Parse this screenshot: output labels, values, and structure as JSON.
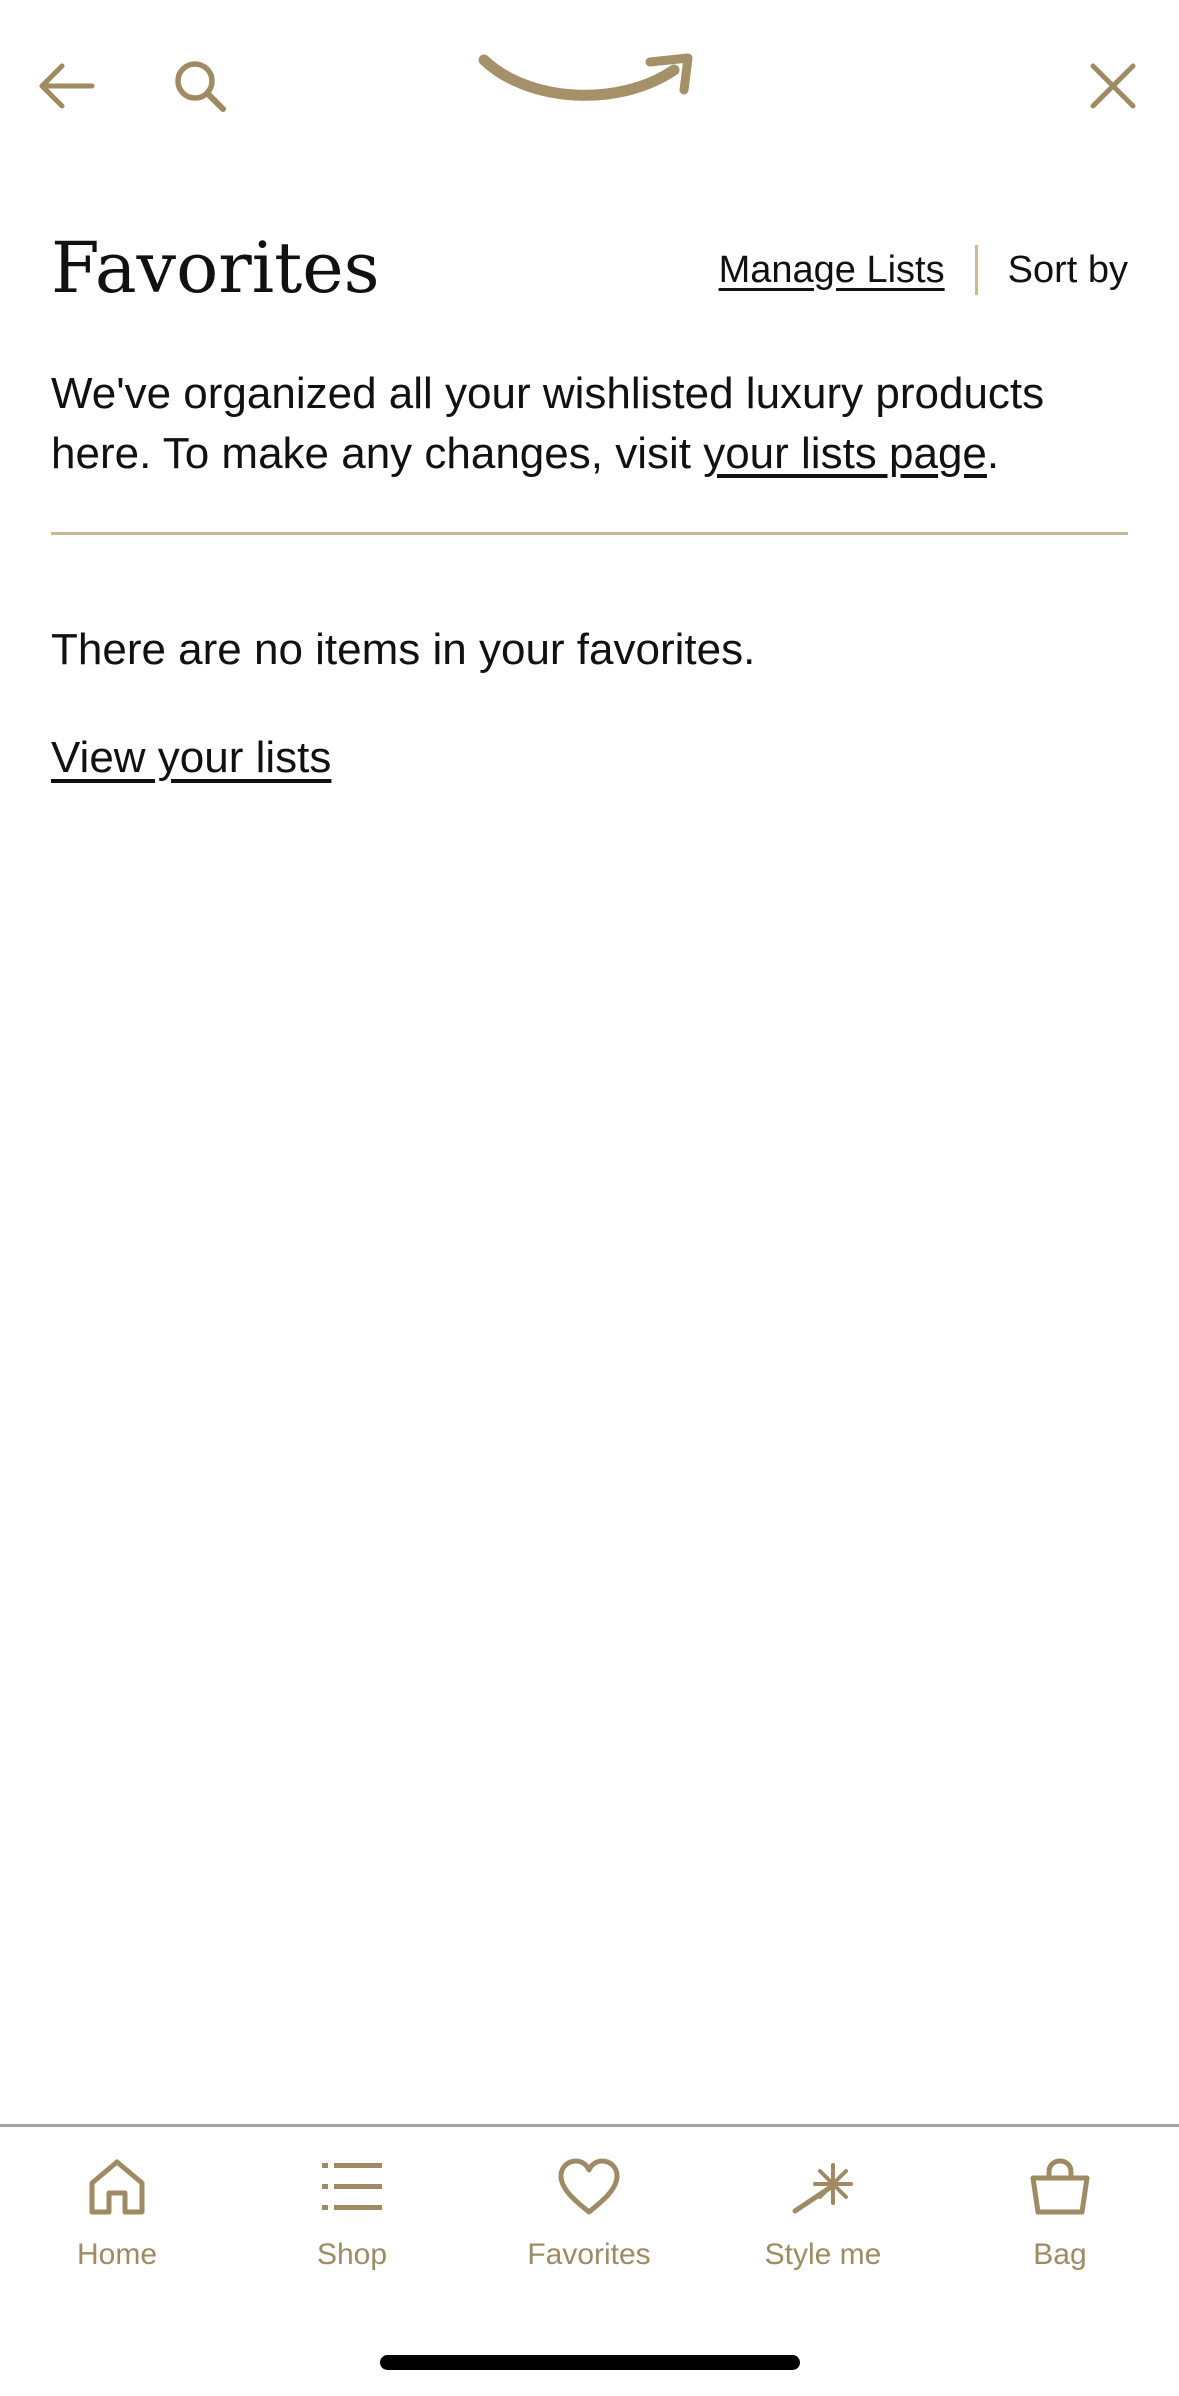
{
  "colors": {
    "accent": "#9e8b63",
    "logo": "#a4916a",
    "divider": "#c8b892",
    "text": "#111111",
    "nav_border": "#a3a3a3",
    "background": "#ffffff"
  },
  "topbar": {
    "back_icon": "arrow-left-icon",
    "search_icon": "search-icon",
    "logo_icon": "amazon-smile-logo",
    "close_icon": "close-icon"
  },
  "header": {
    "title": "Favorites",
    "manage_lists_label": "Manage Lists",
    "sort_by_label": "Sort by"
  },
  "intro": {
    "text_before_link": "We've organized all your wishlisted luxury products here.  To make any changes, visit ",
    "link_text": "your lists page",
    "text_after_link": "."
  },
  "empty_state": {
    "message": "There are no items in your favorites.",
    "view_lists_label": "View your lists"
  },
  "bottom_nav": {
    "items": [
      {
        "label": "Home",
        "icon": "home-icon"
      },
      {
        "label": "Shop",
        "icon": "list-icon"
      },
      {
        "label": "Favorites",
        "icon": "heart-icon"
      },
      {
        "label": "Style me",
        "icon": "magic-wand-icon"
      },
      {
        "label": "Bag",
        "icon": "shopping-bag-icon"
      }
    ]
  }
}
